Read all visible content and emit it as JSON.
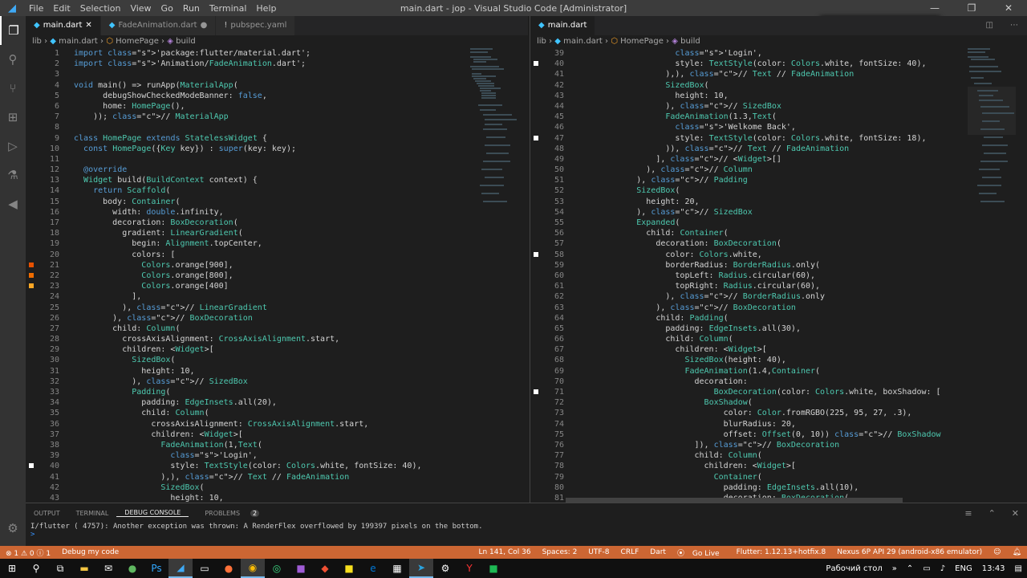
{
  "window": {
    "title": "main.dart - jop - Visual Studio Code [Administrator]",
    "menu": [
      "File",
      "Edit",
      "Selection",
      "View",
      "Go",
      "Run",
      "Terminal",
      "Help"
    ]
  },
  "left_tabs": [
    "main.dart",
    "FadeAnimation.dart",
    "pubspec.yaml"
  ],
  "right_tabs": [
    "main.dart"
  ],
  "breadcrumb": {
    "lib": "lib",
    "file": "main.dart",
    "cls": "HomePage",
    "method": "build"
  },
  "left_code": [
    [
      "1",
      "import 'package:flutter/material.dart';"
    ],
    [
      "2",
      "import 'Animation/FadeAnimation.dart';"
    ],
    [
      "3",
      ""
    ],
    [
      "4",
      "void main() => runApp(MaterialApp("
    ],
    [
      "5",
      "      debugShowCheckedModeBanner: false,"
    ],
    [
      "6",
      "      home: HomePage(),"
    ],
    [
      "7",
      "    )); // MaterialApp"
    ],
    [
      "8",
      ""
    ],
    [
      "9",
      "class HomePage extends StatelessWidget {"
    ],
    [
      "10",
      "  const HomePage({Key key}) : super(key: key);"
    ],
    [
      "11",
      ""
    ],
    [
      "12",
      "  @override"
    ],
    [
      "13",
      "  Widget build(BuildContext context) {"
    ],
    [
      "14",
      "    return Scaffold("
    ],
    [
      "15",
      "      body: Container("
    ],
    [
      "16",
      "        width: double.infinity,"
    ],
    [
      "17",
      "        decoration: BoxDecoration("
    ],
    [
      "18",
      "          gradient: LinearGradient("
    ],
    [
      "19",
      "            begin: Alignment.topCenter,"
    ],
    [
      "20",
      "            colors: ["
    ],
    [
      "21",
      "              Colors.orange[900],"
    ],
    [
      "22",
      "              Colors.orange[800],"
    ],
    [
      "23",
      "              Colors.orange[400]"
    ],
    [
      "24",
      "            ],"
    ],
    [
      "25",
      "          ), // LinearGradient"
    ],
    [
      "26",
      "        ), // BoxDecoration"
    ],
    [
      "27",
      "        child: Column("
    ],
    [
      "28",
      "          crossAxisAlignment: CrossAxisAlignment.start,"
    ],
    [
      "29",
      "          children: <Widget>["
    ],
    [
      "30",
      "            SizedBox("
    ],
    [
      "31",
      "              height: 10,"
    ],
    [
      "32",
      "            ), // SizedBox"
    ],
    [
      "33",
      "            Padding("
    ],
    [
      "34",
      "              padding: EdgeInsets.all(20),"
    ],
    [
      "35",
      "              child: Column("
    ],
    [
      "36",
      "                crossAxisAlignment: CrossAxisAlignment.start,"
    ],
    [
      "37",
      "                children: <Widget>["
    ],
    [
      "38",
      "                  FadeAnimation(1,Text("
    ],
    [
      "39",
      "                    'Login',"
    ],
    [
      "40",
      "                    style: TextStyle(color: Colors.white, fontSize: 40),"
    ],
    [
      "41",
      "                  ),), // Text // FadeAnimation"
    ],
    [
      "42",
      "                  SizedBox("
    ],
    [
      "43",
      "                    height: 10,"
    ]
  ],
  "right_code": [
    [
      "39",
      "                    'Login',"
    ],
    [
      "40",
      "                    style: TextStyle(color: Colors.white, fontSize: 40),"
    ],
    [
      "41",
      "                  ),), // Text // FadeAnimation"
    ],
    [
      "42",
      "                  SizedBox("
    ],
    [
      "43",
      "                    height: 10,"
    ],
    [
      "44",
      "                  ), // SizedBox"
    ],
    [
      "45",
      "                  FadeAnimation(1.3,Text("
    ],
    [
      "46",
      "                    'Welkome Back',"
    ],
    [
      "47",
      "                    style: TextStyle(color: Colors.white, fontSize: 18),"
    ],
    [
      "48",
      "                  )), // Text // FadeAnimation"
    ],
    [
      "49",
      "                ], // <Widget>[]"
    ],
    [
      "50",
      "              ), // Column"
    ],
    [
      "51",
      "            ), // Padding"
    ],
    [
      "52",
      "            SizedBox("
    ],
    [
      "53",
      "              height: 20,"
    ],
    [
      "54",
      "            ), // SizedBox"
    ],
    [
      "55",
      "            Expanded("
    ],
    [
      "56",
      "              child: Container("
    ],
    [
      "57",
      "                decoration: BoxDecoration("
    ],
    [
      "58",
      "                  color: Colors.white,"
    ],
    [
      "59",
      "                  borderRadius: BorderRadius.only("
    ],
    [
      "60",
      "                    topLeft: Radius.circular(60),"
    ],
    [
      "61",
      "                    topRight: Radius.circular(60),"
    ],
    [
      "62",
      "                  ), // BorderRadius.only"
    ],
    [
      "63",
      "                ), // BoxDecoration"
    ],
    [
      "64",
      "                child: Padding("
    ],
    [
      "65",
      "                  padding: EdgeInsets.all(30),"
    ],
    [
      "66",
      "                  child: Column("
    ],
    [
      "67",
      "                    children: <Widget>["
    ],
    [
      "68",
      "                      SizedBox(height: 40),"
    ],
    [
      "69",
      "                      FadeAnimation(1.4,Container("
    ],
    [
      "70",
      "                        decoration:"
    ],
    [
      "71",
      "                            BoxDecoration(color: Colors.white, boxShadow: ["
    ],
    [
      "72",
      "                          BoxShadow("
    ],
    [
      "73",
      "                              color: Color.fromRGBO(225, 95, 27, .3),"
    ],
    [
      "74",
      "                              blurRadius: 20,"
    ],
    [
      "75",
      "                              offset: Offset(0, 10)) // BoxShadow"
    ],
    [
      "76",
      "                        ]), // BoxDecoration"
    ],
    [
      "77",
      "                        child: Column("
    ],
    [
      "78",
      "                          children: <Widget>["
    ],
    [
      "79",
      "                            Container("
    ],
    [
      "80",
      "                              padding: EdgeInsets.all(10),"
    ],
    [
      "81",
      "                              decoration: BoxDecoration("
    ]
  ],
  "panel": {
    "tabs": [
      "OUTPUT",
      "TERMINAL",
      "DEBUG CONSOLE",
      "PROBLEMS"
    ],
    "problems_count": "2",
    "output": "I/flutter ( 4757): Another exception was thrown: A RenderFlex overflowed by 199397 pixels on the bottom.",
    "prompt": ">"
  },
  "status": {
    "errors": "⊗ 1 ⚠ 0 ⓘ 1",
    "debug": "Debug my code",
    "position": "Ln 141, Col 36",
    "spaces": "Spaces: 2",
    "encoding": "UTF-8",
    "eol": "CRLF",
    "lang": "Dart",
    "golive": "Go Live",
    "flutter": "Flutter: 1.12.13+hotfix.8",
    "device": "Nexus 6P API 29 (android-x86 emulator)"
  },
  "taskbar": {
    "desktop": "Рабочий стол",
    "lang": "ENG",
    "time": "13:43"
  },
  "colors": {
    "status": "#cc6633",
    "accent": "#007acc"
  }
}
